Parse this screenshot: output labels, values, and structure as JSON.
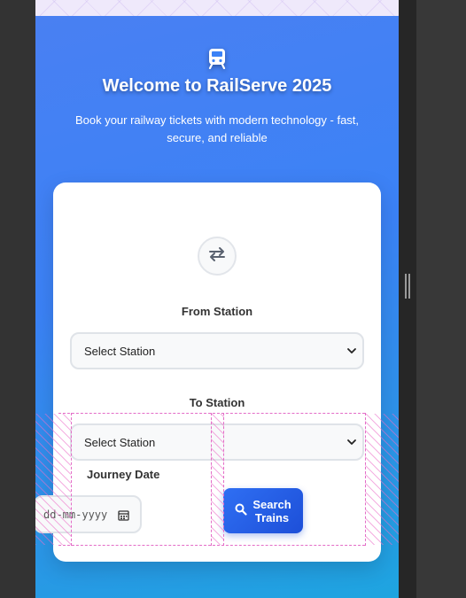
{
  "hero": {
    "icon": "train-icon",
    "title": "Welcome to RailServe 2025",
    "subtitle": "Book your railway tickets with modern technology - fast, secure, and reliable"
  },
  "form": {
    "swap_icon": "swap-arrows-icon",
    "from_label": "From Station",
    "from_value": "Select Station",
    "to_label": "To Station",
    "to_value": "Select Station",
    "date_label": "Journey Date",
    "date_placeholder": "dd-mm-yyyy",
    "search_label_line1": "Search",
    "search_label_line2": "Trains"
  },
  "colors": {
    "hero_gradient_start": "#4a80f2",
    "hero_gradient_end": "#1ea5e0",
    "button": "#2563eb",
    "overlay": "#e36cc7"
  }
}
